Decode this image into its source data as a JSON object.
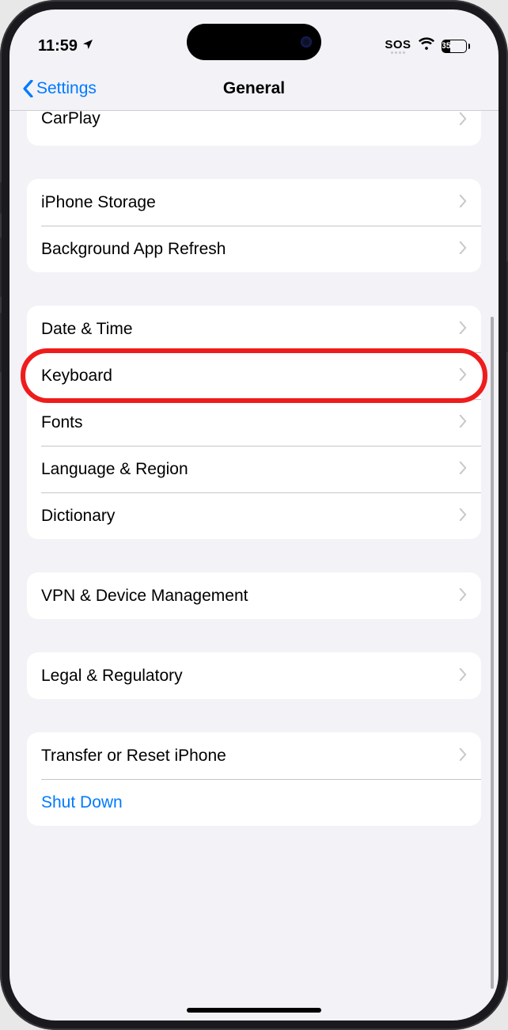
{
  "status": {
    "time": "11:59",
    "sos": "SOS",
    "battery": "35"
  },
  "nav": {
    "back": "Settings",
    "title": "General"
  },
  "groups": [
    {
      "style": "partial-top",
      "rows": [
        {
          "label": "CarPlay",
          "partial": true
        }
      ]
    },
    {
      "rows": [
        {
          "label": "iPhone Storage"
        },
        {
          "label": "Background App Refresh"
        }
      ]
    },
    {
      "rows": [
        {
          "label": "Date & Time"
        },
        {
          "label": "Keyboard",
          "highlight": true
        },
        {
          "label": "Fonts"
        },
        {
          "label": "Language & Region"
        },
        {
          "label": "Dictionary"
        }
      ]
    },
    {
      "rows": [
        {
          "label": "VPN & Device Management"
        }
      ]
    },
    {
      "rows": [
        {
          "label": "Legal & Regulatory"
        }
      ]
    },
    {
      "rows": [
        {
          "label": "Transfer or Reset iPhone"
        },
        {
          "label": "Shut Down",
          "link": true
        }
      ]
    }
  ]
}
